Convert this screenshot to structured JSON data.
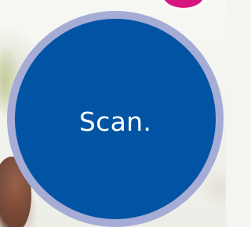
{
  "button": {
    "label": "Scan."
  },
  "colors": {
    "disc": "#0054a3",
    "ring": "#a5acd6",
    "accent_dot": "#d6157e",
    "text": "#ffffff"
  }
}
